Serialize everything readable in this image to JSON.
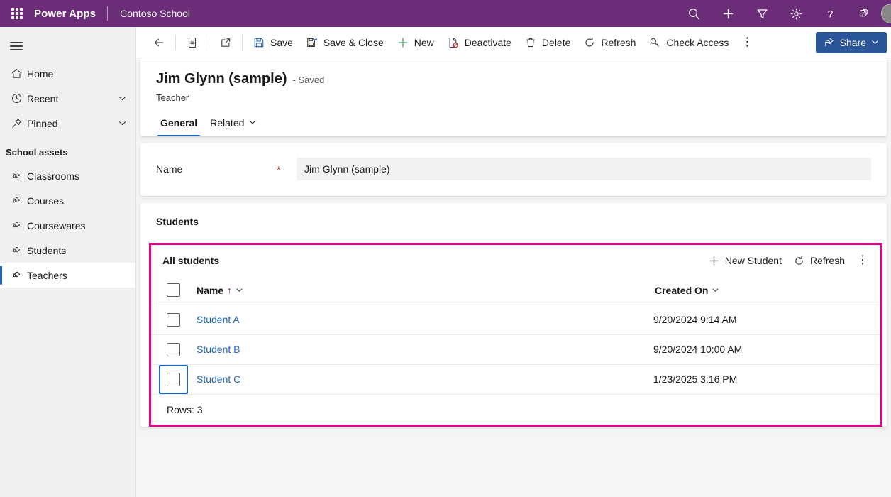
{
  "topbar": {
    "brand": "Power Apps",
    "environment": "Contoso School",
    "waffle_name": "app-launcher",
    "icons": [
      {
        "name": "search-icon",
        "label": "Search"
      },
      {
        "name": "plus-icon",
        "label": "New"
      },
      {
        "name": "filter-icon",
        "label": "Filter"
      },
      {
        "name": "gear-icon",
        "label": "Settings"
      },
      {
        "name": "help-icon",
        "label": "Help"
      },
      {
        "name": "copilot-icon",
        "label": "Copilot"
      }
    ],
    "avatar_name": "user-avatar"
  },
  "sidebar": {
    "items": [
      {
        "label": "Home",
        "icon": "home-icon",
        "chevron": false,
        "selected": false
      },
      {
        "label": "Recent",
        "icon": "clock-icon",
        "chevron": true,
        "selected": false
      },
      {
        "label": "Pinned",
        "icon": "pin-icon",
        "chevron": true,
        "selected": false
      }
    ],
    "group_title": "School assets",
    "entities": [
      {
        "label": "Classrooms",
        "icon": "entity-icon",
        "selected": false
      },
      {
        "label": "Courses",
        "icon": "entity-icon",
        "selected": false
      },
      {
        "label": "Coursewares",
        "icon": "entity-icon",
        "selected": false
      },
      {
        "label": "Students",
        "icon": "entity-icon",
        "selected": false
      },
      {
        "label": "Teachers",
        "icon": "entity-icon",
        "selected": true
      }
    ]
  },
  "commandbar": {
    "back_label": "Back",
    "form_label": "Form",
    "popout_label": "Open in new window",
    "save": "Save",
    "save_close": "Save & Close",
    "new": "New",
    "deactivate": "Deactivate",
    "delete": "Delete",
    "refresh": "Refresh",
    "check_access": "Check Access",
    "overflow": "⋮",
    "share": "Share"
  },
  "record": {
    "title": "Jim Glynn (sample)",
    "status": "- Saved",
    "subtitle": "Teacher",
    "tabs": [
      {
        "label": "General",
        "active": true,
        "chevron": false
      },
      {
        "label": "Related",
        "active": false,
        "chevron": true
      }
    ]
  },
  "name_field": {
    "label": "Name",
    "required_mark": "*",
    "value": "Jim Glynn (sample)",
    "placeholder": "---"
  },
  "subgrid": {
    "section_label": "Students",
    "view_name": "All students",
    "new_label": "New Student",
    "refresh_label": "Refresh",
    "overflow": "⋮",
    "columns": [
      {
        "label": "Name",
        "sort": "↑",
        "chevron": true
      },
      {
        "label": "Created On",
        "sort": "",
        "chevron": true
      }
    ],
    "rows": [
      {
        "name": "Student A",
        "created_on": "9/20/2024 9:14 AM",
        "checked": false,
        "focused": false
      },
      {
        "name": "Student B",
        "created_on": "9/20/2024 10:00 AM",
        "checked": false,
        "focused": false
      },
      {
        "name": "Student C",
        "created_on": "1/23/2025 3:16 PM",
        "checked": false,
        "focused": true
      }
    ],
    "footer": "Rows: 3"
  },
  "colors": {
    "header_purple": "#6B2D78",
    "accent_blue": "#2266BB",
    "share_blue": "#2B579A",
    "highlight_magenta": "#E3008C",
    "required_red": "#A4262C"
  }
}
